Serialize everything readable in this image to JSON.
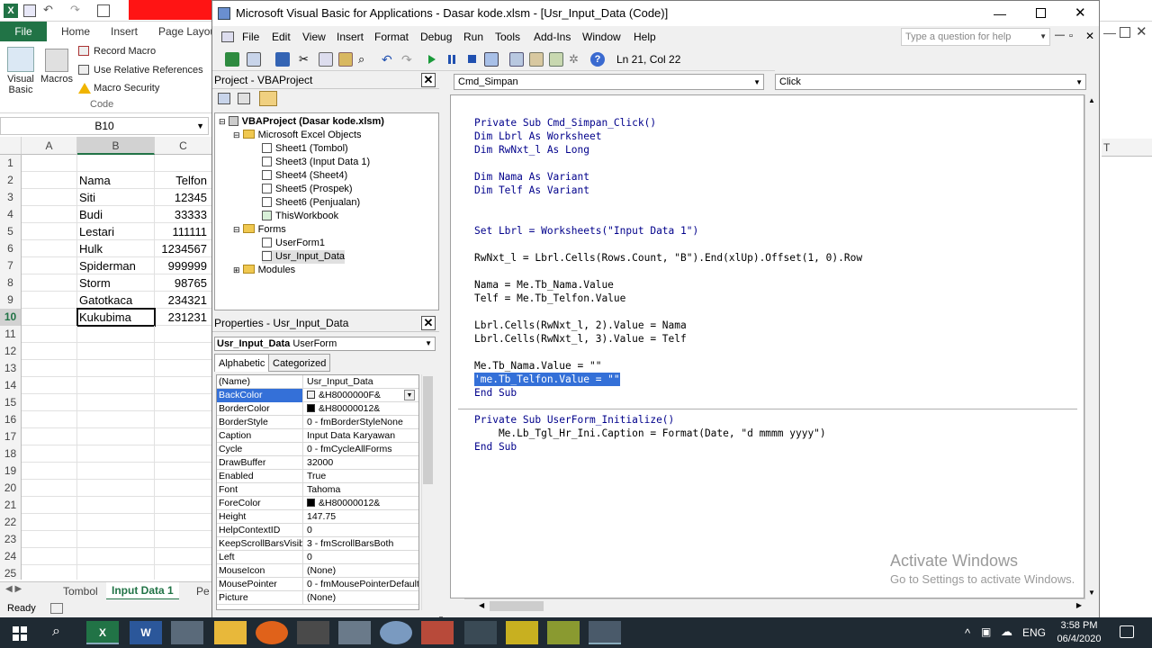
{
  "excel": {
    "file_tab": "File",
    "ribbon_tabs": [
      "Home",
      "Insert",
      "Page Layout"
    ],
    "ribbon": {
      "visual_basic": "Visual Basic",
      "macros": "Macros",
      "record_macro": "Record Macro",
      "use_relative": "Use Relative References",
      "macro_security": "Macro Security",
      "group_label": "Code"
    },
    "name_box": "B10",
    "columns": [
      "A",
      "B",
      "C"
    ],
    "rows": [
      {
        "n": "1",
        "b": "",
        "c": ""
      },
      {
        "n": "2",
        "b": "Nama",
        "c": "Telfon"
      },
      {
        "n": "3",
        "b": "Siti",
        "c": "12345"
      },
      {
        "n": "4",
        "b": "Budi",
        "c": "33333"
      },
      {
        "n": "5",
        "b": "Lestari",
        "c": "111111"
      },
      {
        "n": "6",
        "b": "Hulk",
        "c": "1234567"
      },
      {
        "n": "7",
        "b": "Spiderman",
        "c": "999999"
      },
      {
        "n": "8",
        "b": "Storm",
        "c": "98765"
      },
      {
        "n": "9",
        "b": "Gatotkaca",
        "c": "234321"
      },
      {
        "n": "10",
        "b": "Kukubima",
        "c": "231231"
      },
      {
        "n": "11",
        "b": "",
        "c": ""
      },
      {
        "n": "12",
        "b": "",
        "c": ""
      },
      {
        "n": "13",
        "b": "",
        "c": ""
      },
      {
        "n": "14",
        "b": "",
        "c": ""
      },
      {
        "n": "15",
        "b": "",
        "c": ""
      },
      {
        "n": "16",
        "b": "",
        "c": ""
      },
      {
        "n": "17",
        "b": "",
        "c": ""
      },
      {
        "n": "18",
        "b": "",
        "c": ""
      },
      {
        "n": "19",
        "b": "",
        "c": ""
      },
      {
        "n": "20",
        "b": "",
        "c": ""
      },
      {
        "n": "21",
        "b": "",
        "c": ""
      },
      {
        "n": "22",
        "b": "",
        "c": ""
      },
      {
        "n": "23",
        "b": "",
        "c": ""
      },
      {
        "n": "24",
        "b": "",
        "c": ""
      },
      {
        "n": "25",
        "b": "",
        "c": ""
      }
    ],
    "sheet_tabs": [
      "Tombol",
      "Input Data 1",
      "Pe"
    ],
    "status": "Ready",
    "right_col": "T",
    "accent": "#217346"
  },
  "vbe": {
    "title": "Microsoft Visual Basic for Applications - Dasar kode.xlsm - [Usr_Input_Data (Code)]",
    "menu": [
      "File",
      "Edit",
      "View",
      "Insert",
      "Format",
      "Debug",
      "Run",
      "Tools",
      "Add-Ins",
      "Window",
      "Help"
    ],
    "help_search": "Type a question for help",
    "position": "Ln 21, Col 22",
    "project": {
      "title": "Project - VBAProject",
      "root": "VBAProject (Dasar kode.xlsm)",
      "excel_objects": "Microsoft Excel Objects",
      "sheets": [
        "Sheet1 (Tombol)",
        "Sheet3 (Input Data 1)",
        "Sheet4 (Sheet4)",
        "Sheet5 (Prospek)",
        "Sheet6 (Penjualan)",
        "ThisWorkbook"
      ],
      "forms": "Forms",
      "form_items": [
        "UserForm1",
        "Usr_Input_Data"
      ],
      "modules": "Modules"
    },
    "properties": {
      "title": "Properties - Usr_Input_Data",
      "object": "Usr_Input_Data",
      "object_type": "UserForm",
      "tabs": [
        "Alphabetic",
        "Categorized"
      ],
      "rows": [
        {
          "name": "(Name)",
          "value": "Usr_Input_Data",
          "swatch": ""
        },
        {
          "name": "BackColor",
          "value": "&H8000000F&",
          "swatch": "#f0f0f0"
        },
        {
          "name": "BorderColor",
          "value": "&H80000012&",
          "swatch": "#000000"
        },
        {
          "name": "BorderStyle",
          "value": "0 - fmBorderStyleNone",
          "swatch": ""
        },
        {
          "name": "Caption",
          "value": "Input Data Karyawan",
          "swatch": ""
        },
        {
          "name": "Cycle",
          "value": "0 - fmCycleAllForms",
          "swatch": ""
        },
        {
          "name": "DrawBuffer",
          "value": "32000",
          "swatch": ""
        },
        {
          "name": "Enabled",
          "value": "True",
          "swatch": ""
        },
        {
          "name": "Font",
          "value": "Tahoma",
          "swatch": ""
        },
        {
          "name": "ForeColor",
          "value": "&H80000012&",
          "swatch": "#000000"
        },
        {
          "name": "Height",
          "value": "147.75",
          "swatch": ""
        },
        {
          "name": "HelpContextID",
          "value": "0",
          "swatch": ""
        },
        {
          "name": "KeepScrollBarsVisible",
          "value": "3 - fmScrollBarsBoth",
          "swatch": ""
        },
        {
          "name": "Left",
          "value": "0",
          "swatch": ""
        },
        {
          "name": "MouseIcon",
          "value": "(None)",
          "swatch": ""
        },
        {
          "name": "MousePointer",
          "value": "0 - fmMousePointerDefault",
          "swatch": ""
        },
        {
          "name": "Picture",
          "value": "(None)",
          "swatch": ""
        }
      ]
    },
    "code": {
      "object_combo": "Cmd_Simpan",
      "proc_combo": "Click",
      "lines": [
        "",
        "Private Sub Cmd_Simpan_Click()",
        "Dim Lbrl As Worksheet",
        "Dim RwNxt_l As Long",
        "",
        "Dim Nama As Variant",
        "Dim Telf As Variant",
        "",
        "",
        "Set Lbrl = Worksheets(\"Input Data 1\")",
        "",
        "RwNxt_l = Lbrl.Cells(Rows.Count, \"B\").End(xlUp).Offset(1, 0).Row",
        "",
        "Nama = Me.Tb_Nama.Value",
        "Telf = Me.Tb_Telfon.Value",
        "",
        "Lbrl.Cells(RwNxt_l, 2).Value = Nama",
        "Lbrl.Cells(RwNxt_l, 3).Value = Telf",
        "",
        "Me.Tb_Nama.Value = \"\"",
        "'me.Tb_Telfon.Value = \"\"",
        "End Sub",
        "",
        "Private Sub UserForm_Initialize()",
        "    Me.Lb_Tgl_Hr_Ini.Caption = Format(Date, \"d mmmm yyyy\")",
        "End Sub"
      ],
      "keyword_color": "#00008b",
      "selection_color": "#3470d8"
    },
    "watermark": {
      "line1": "Activate Windows",
      "line2": "Go to Settings to activate Windows."
    }
  },
  "taskbar": {
    "lang": "ENG",
    "time": "3:58 PM",
    "date": "06/4/2020"
  }
}
